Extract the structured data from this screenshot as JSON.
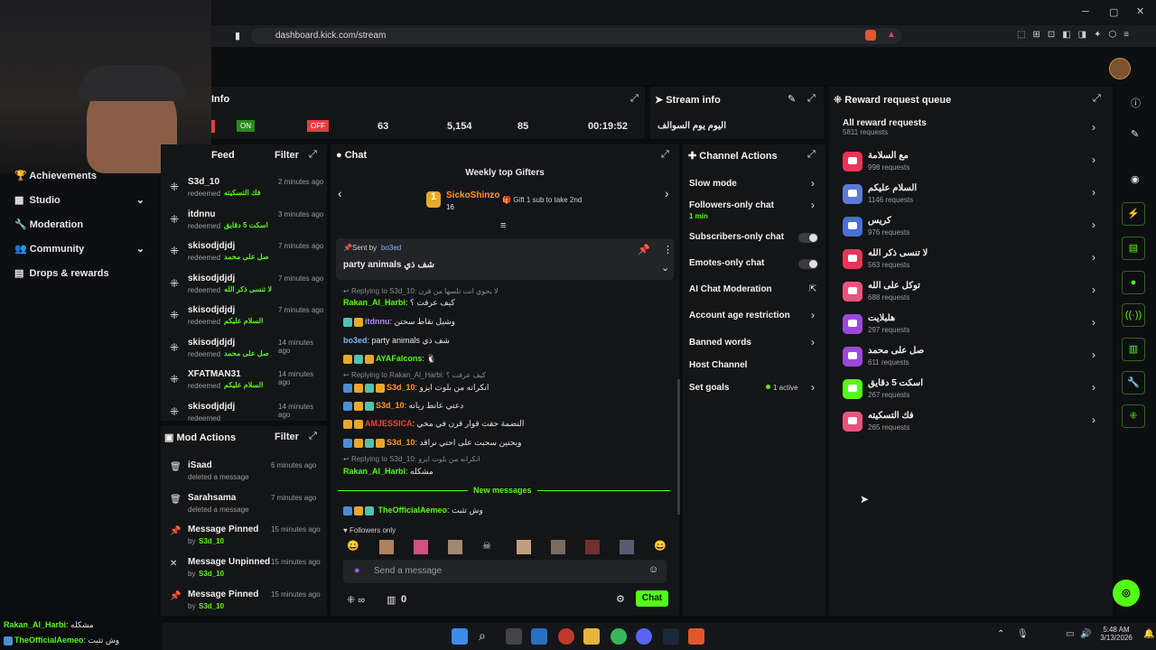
{
  "browser": {
    "url": "dashboard.kick.com/stream"
  },
  "sidebar": {
    "items": [
      {
        "label": "Achievements"
      },
      {
        "label": "Studio"
      },
      {
        "label": "Moderation"
      },
      {
        "label": "Community"
      },
      {
        "label": "Drops & rewards"
      }
    ]
  },
  "stream_info_bar": {
    "title": "Info",
    "on": "ON",
    "off": "OFF",
    "stat1": "63",
    "stat2": "5,154",
    "stat3": "85",
    "uptime": "00:19:52"
  },
  "stream_info": {
    "title": "Stream info",
    "stream_title": "اليوم يوم السوالف"
  },
  "feed": {
    "title": "Feed",
    "filter": "Filter",
    "items": [
      {
        "user": "S3d_10",
        "action": "redeemed",
        "reward": "فك التسكيته",
        "time": "2 minutes ago"
      },
      {
        "user": "itdnnu",
        "action": "redeemed",
        "reward": "اسكت 5 دقايق",
        "time": "3 minutes ago"
      },
      {
        "user": "skisodjdjdj",
        "action": "redeemed",
        "reward": "صل على محمد",
        "time": "7 minutes ago"
      },
      {
        "user": "skisodjdjdj",
        "action": "redeemed",
        "reward": "لا تنسى ذكر الله",
        "time": "7 minutes ago"
      },
      {
        "user": "skisodjdjdj",
        "action": "redeemed",
        "reward": "السلام عليكم",
        "time": "7 minutes ago"
      },
      {
        "user": "skisodjdjdj",
        "action": "redeemed",
        "reward": "صل على محمد",
        "time": "14 minutes ago"
      },
      {
        "user": "XFATMAN31",
        "action": "redeemed",
        "reward": "السلام عليكم",
        "time": "14 minutes ago"
      },
      {
        "user": "skisodjdjdj",
        "action": "redeemed",
        "reward": "",
        "time": "14 minutes ago"
      }
    ]
  },
  "mod_actions": {
    "title": "Mod Actions",
    "filter": "Filter",
    "items": [
      {
        "title": "iSaad",
        "sub": "deleted a message",
        "time": "6 minutes ago"
      },
      {
        "title": "Sarahsama",
        "sub": "deleted a message",
        "time": "7 minutes ago"
      },
      {
        "title": "Message Pinned",
        "sub_prefix": "by",
        "user": "S3d_10",
        "time": "15 minutes ago"
      },
      {
        "title": "Message Unpinned",
        "sub_prefix": "by",
        "user": "S3d_10",
        "time": "15 minutes ago"
      },
      {
        "title": "Message Pinned",
        "sub_prefix": "by",
        "user": "S3d_10",
        "time": "15 minutes ago"
      }
    ]
  },
  "chat": {
    "title": "Chat",
    "gifters_title": "Weekly top Gifters",
    "top_gifter": "SickoShinzo",
    "top_gifter_count": "16",
    "gift_hint": "Gift 1 sub to take 2nd",
    "pinned": {
      "sent_by_label": "Sent by",
      "sent_by": "bo3ed",
      "text": "party animals شف ذي"
    },
    "lines": [
      {
        "reply": "Replying to S3d_10: لا يحوي انت تلسها من قرن"
      },
      {
        "user": "Rakan_Al_Harbi",
        "text": ": كيف عرفت ؟",
        "color": "#53fc18"
      },
      {
        "user": "itdnnu",
        "text": ": وشيل نقاط سحتن",
        "color": "#b48cff"
      },
      {
        "user": "bo3ed",
        "text": ": party animals شف ذي",
        "color": "#7fb6ff"
      },
      {
        "user": "AYAFalcons",
        "text": ": 🐧",
        "color": "#53fc18"
      },
      {
        "reply": "Replying to Rakan_Al_Harbi: كيف عرفت ؟"
      },
      {
        "user": "S3d_10",
        "text": ": انكرانه من بلوت ايزو",
        "color": "#ff9a2a"
      },
      {
        "user": "S3d_10",
        "text": ": دعني عانط ريانه",
        "color": "#ff9a2a"
      },
      {
        "user": "AMJESSICA",
        "text": ": النضمة حقت قوار قرن في مخي",
        "color": "#ff3b3b"
      },
      {
        "user": "S3d_10",
        "text": ": وبحتين سحبت على احتي نراقد",
        "color": "#ff9a2a"
      },
      {
        "reply": "Replying to S3d_10: انكرانه من بلوت ايزو"
      },
      {
        "user": "Rakan_Al_Harbi",
        "text": ": مشكله",
        "color": "#53fc18"
      }
    ],
    "new_messages": "New messages",
    "last": {
      "user": "TheOfficialAemeo",
      "text": ": وش تثبت"
    },
    "followers_only": "Followers only",
    "input_placeholder": "Send a message",
    "points": "0",
    "send_label": "Chat"
  },
  "channel_actions": {
    "title": "Channel Actions",
    "items": [
      {
        "label": "Slow mode",
        "kind": "arrow"
      },
      {
        "label": "Followers-only chat",
        "sub": "1 min",
        "kind": "arrow"
      },
      {
        "label": "Subscribers-only chat",
        "kind": "toggle"
      },
      {
        "label": "Emotes-only chat",
        "kind": "toggle"
      },
      {
        "label": "AI Chat Moderation",
        "kind": "external"
      },
      {
        "label": "Account age restriction",
        "kind": "arrow"
      },
      {
        "label": "Banned words",
        "kind": "arrow"
      },
      {
        "label": "Host Channel",
        "kind": "none"
      },
      {
        "label": "Set goals",
        "badge": "1 active",
        "kind": "arrow"
      }
    ]
  },
  "reward_queue": {
    "title": "Reward request queue",
    "all": {
      "label": "All reward requests",
      "count": "5811 requests"
    },
    "items": [
      {
        "name": "مع السلامة",
        "count": "998 requests",
        "color": "#e6375a"
      },
      {
        "name": "السلام عليكم",
        "count": "1146 requests",
        "color": "#5b7bd5"
      },
      {
        "name": "كريس",
        "count": "976 requests",
        "color": "#4a6fd6"
      },
      {
        "name": "لا تنسى ذكر الله",
        "count": "563 requests",
        "color": "#e6375a"
      },
      {
        "name": "توكل على الله",
        "count": "688 requests",
        "color": "#e8557a"
      },
      {
        "name": "هلبلايت",
        "count": "297 requests",
        "color": "#9b49d8"
      },
      {
        "name": "صل على محمد",
        "count": "611 requests",
        "color": "#9b49d8"
      },
      {
        "name": "اسكت 5 دقايق",
        "count": "267 requests",
        "color": "#53fc18"
      },
      {
        "name": "فك التسكيته",
        "count": "265 requests",
        "color": "#e8557a"
      }
    ]
  },
  "overlay_chat": [
    {
      "user": "Rakan_Al_Harbi",
      "text": ": مشكله"
    },
    {
      "user": "TheOfficialAemeo",
      "text": ": وش تثبت"
    }
  ],
  "taskbar": {
    "time": "5:48 AM",
    "date": "3/13/2026"
  }
}
